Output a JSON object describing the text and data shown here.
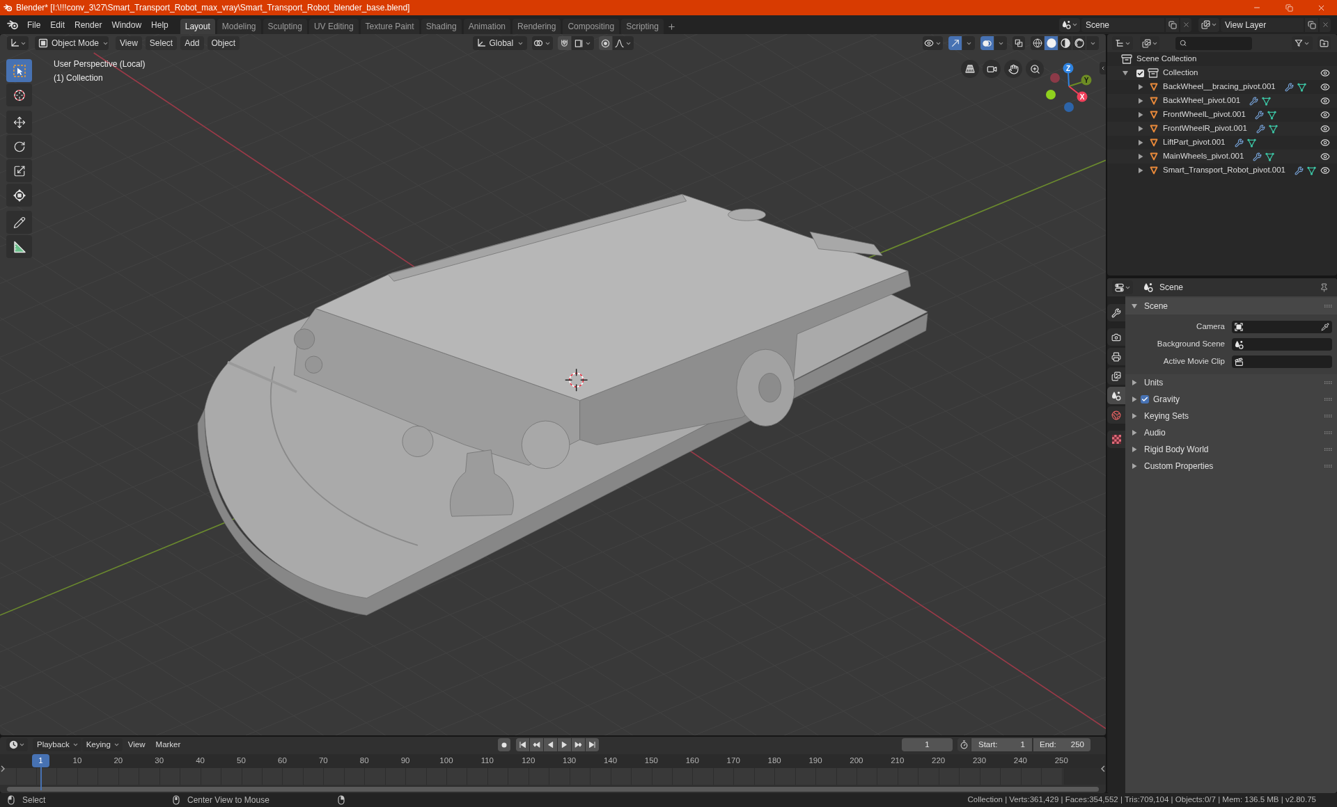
{
  "window": {
    "title": "Blender* [I:\\!!!conv_3\\27\\Smart_Transport_Robot_max_vray\\Smart_Transport_Robot_blender_base.blend]"
  },
  "menubar": {
    "menus": [
      "File",
      "Edit",
      "Render",
      "Window",
      "Help"
    ],
    "workspaces": [
      {
        "label": "Layout",
        "selected": true
      },
      {
        "label": "Modeling",
        "selected": false
      },
      {
        "label": "Sculpting",
        "selected": false
      },
      {
        "label": "UV Editing",
        "selected": false
      },
      {
        "label": "Texture Paint",
        "selected": false
      },
      {
        "label": "Shading",
        "selected": false
      },
      {
        "label": "Animation",
        "selected": false
      },
      {
        "label": "Rendering",
        "selected": false
      },
      {
        "label": "Compositing",
        "selected": false
      },
      {
        "label": "Scripting",
        "selected": false
      }
    ],
    "scene": "Scene",
    "view_layer": "View Layer"
  },
  "viewport": {
    "header": {
      "mode": "Object Mode",
      "menus": [
        "View",
        "Select",
        "Add",
        "Object"
      ],
      "orientation": "Global",
      "gizmos": true,
      "overlays": true,
      "xray": false,
      "shading": [
        {
          "kind": "wireframe",
          "selected": false
        },
        {
          "kind": "solid",
          "selected": true
        },
        {
          "kind": "material",
          "selected": false
        },
        {
          "kind": "rendered",
          "selected": false
        }
      ]
    },
    "toolbar": [
      {
        "tools": [
          {
            "kind": "select_box",
            "selected": true
          },
          {
            "kind": "cursor",
            "selected": false
          }
        ]
      },
      {
        "tools": [
          {
            "kind": "move",
            "selected": false
          },
          {
            "kind": "rotate",
            "selected": false
          },
          {
            "kind": "scale",
            "selected": false
          },
          {
            "kind": "transform",
            "selected": false
          }
        ]
      },
      {
        "tools": [
          {
            "kind": "annotate",
            "selected": false
          },
          {
            "kind": "measure",
            "selected": false
          }
        ]
      }
    ],
    "info": [
      "User Perspective (Local)",
      "(1) Collection"
    ],
    "gizmo": {
      "x": "X",
      "y": "Y",
      "z": "Z"
    }
  },
  "outliner": {
    "root": "Scene Collection",
    "collections": [
      {
        "name": "Collection",
        "expanded": true,
        "checked": true,
        "visible": true,
        "children": [
          {
            "name": "BackWheel__bracing_pivot.001",
            "expanded": false,
            "visible": true
          },
          {
            "name": "BackWheel_pivot.001",
            "expanded": false,
            "visible": true
          },
          {
            "name": "FrontWheelL_pivot.001",
            "expanded": false,
            "visible": true
          },
          {
            "name": "FrontWheelR_pivot.001",
            "expanded": false,
            "visible": true
          },
          {
            "name": "LiftPart_pivot.001",
            "expanded": false,
            "visible": true
          },
          {
            "name": "MainWheels_pivot.001",
            "expanded": false,
            "visible": true
          },
          {
            "name": "Smart_Transport_Robot_pivot.001",
            "expanded": false,
            "visible": true
          }
        ]
      }
    ]
  },
  "properties": {
    "context": "Scene",
    "tab_groups": [
      {
        "tabs": [
          {
            "kind": "tool",
            "selected": false
          }
        ]
      },
      {
        "tabs": [
          {
            "kind": "render",
            "selected": false
          },
          {
            "kind": "output",
            "selected": false
          },
          {
            "kind": "view_layer",
            "selected": false
          },
          {
            "kind": "scene",
            "selected": true
          },
          {
            "kind": "world",
            "selected": false
          }
        ]
      },
      {
        "tabs": [
          {
            "kind": "texture",
            "selected": false
          }
        ]
      }
    ],
    "panels": [
      {
        "title": "Scene",
        "expanded": true,
        "fields": [
          {
            "kind": "camera",
            "label": "Camera"
          },
          {
            "kind": "scene",
            "label": "Background Scene"
          },
          {
            "kind": "clip",
            "label": "Active Movie Clip"
          }
        ]
      },
      {
        "title": "Units",
        "expanded": false
      },
      {
        "title": "Gravity",
        "expanded": false,
        "checked": true
      },
      {
        "title": "Keying Sets",
        "expanded": false
      },
      {
        "title": "Audio",
        "expanded": false
      },
      {
        "title": "Rigid Body World",
        "expanded": false
      },
      {
        "title": "Custom Properties",
        "expanded": false
      }
    ]
  },
  "timeline": {
    "menus": [
      {
        "label": "Playback",
        "dropdown": true
      },
      {
        "label": "Keying",
        "dropdown": true
      },
      {
        "label": "View",
        "dropdown": false
      },
      {
        "label": "Marker",
        "dropdown": false
      }
    ],
    "auto_keying": false,
    "current_frame": "1",
    "start": {
      "label": "Start:",
      "value": "1"
    },
    "end": {
      "label": "End:",
      "value": "250"
    },
    "playhead": "1",
    "ruler": [
      "10",
      "20",
      "30",
      "40",
      "50",
      "60",
      "70",
      "80",
      "90",
      "100",
      "110",
      "120",
      "130",
      "140",
      "150",
      "160",
      "170",
      "180",
      "190",
      "200",
      "210",
      "220",
      "230",
      "240",
      "250"
    ]
  },
  "status_bar": {
    "hints": [
      {
        "kind": "left",
        "text": "Select"
      },
      {
        "kind": "middle",
        "text": "Center View to Mouse"
      },
      {
        "kind": "right"
      }
    ],
    "stats": "Collection | Verts:361,429 | Faces:354,552 | Tris:709,104 | Objects:0/7 | Mem: 136.5 MB | v2.80.75"
  }
}
